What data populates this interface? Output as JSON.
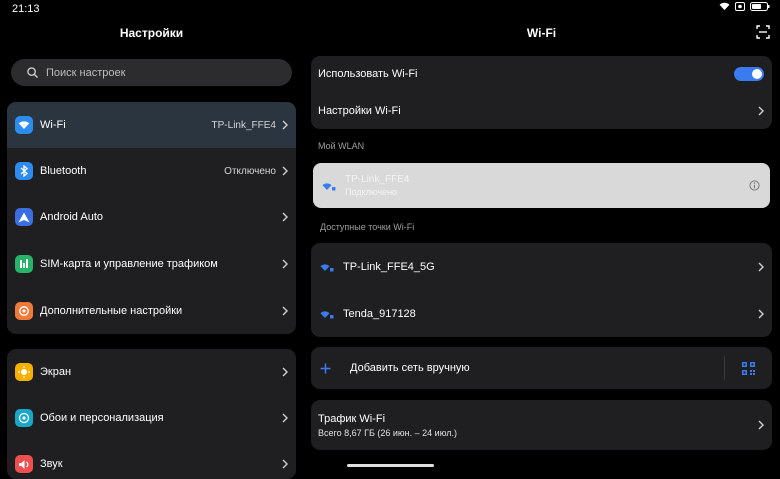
{
  "status": {
    "time": "21:13"
  },
  "left": {
    "title": "Настройки",
    "search_placeholder": "Поиск настроек",
    "group1": [
      {
        "name": "wifi",
        "label": "Wi-Fi",
        "value": "TP-Link_FFE4",
        "icon_color": "#2d8cf0",
        "icon": "wifi-icon",
        "selected": true
      },
      {
        "name": "bluetooth",
        "label": "Bluetooth",
        "value": "Отключено",
        "icon_color": "#2d8cf0",
        "icon": "bluetooth-icon"
      },
      {
        "name": "android-auto",
        "label": "Android Auto",
        "value": "",
        "icon_color": "#3b6fe0",
        "icon": "android-auto-icon"
      },
      {
        "name": "sim",
        "label": "SIM-карта и управление трафиком",
        "value": "",
        "icon_color": "#27b36a",
        "icon": "sim-icon"
      },
      {
        "name": "more",
        "label": "Дополнительные настройки",
        "value": "",
        "icon_color": "#f07a3a",
        "icon": "more-settings-icon"
      }
    ],
    "group2": [
      {
        "name": "display",
        "label": "Экран",
        "icon_color": "#f5b000",
        "icon": "sun-icon"
      },
      {
        "name": "wallpaper",
        "label": "Обои и персонализация",
        "icon_color": "#19a7c9",
        "icon": "palette-icon"
      },
      {
        "name": "sound",
        "label": "Звук",
        "icon_color": "#ef4f4f",
        "icon": "sound-icon"
      }
    ]
  },
  "right": {
    "title": "Wi-Fi",
    "use_wifi_label": "Использовать Wi-Fi",
    "use_wifi_on": true,
    "wifi_settings_label": "Настройки Wi-Fi",
    "my_wlan_label": "Мой WLAN",
    "connected": {
      "ssid": "TP-Link_FFE4",
      "status": "Подключено"
    },
    "available_label": "Доступные точки Wi-Fi",
    "available": [
      {
        "ssid": "TP-Link_FFE4_5G"
      },
      {
        "ssid": "Tenda_917128"
      }
    ],
    "add_network_label": "Добавить сеть вручную",
    "traffic": {
      "title": "Трафик Wi-Fi",
      "detail": "Всего 8,67 ГБ (26 июн. – 24 июл.)"
    }
  },
  "colors": {
    "accent": "#3a7bf0",
    "card": "#1f1f21",
    "selected": "#2b3540"
  }
}
